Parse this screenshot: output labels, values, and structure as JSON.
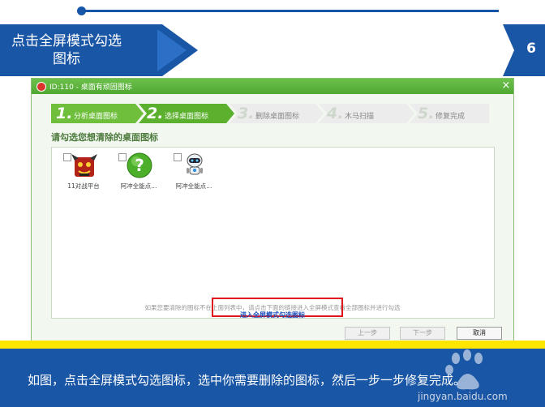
{
  "slide": {
    "title": "点击全屏模式勾选\n图标",
    "page_number": "6",
    "caption": "如图，点击全屏模式勾选图标，选中你需要删除的图标，然后一步一步修复完成。"
  },
  "dialog": {
    "window_title": "ID:110 - 桌面有顽固图标",
    "close_glyph": "×",
    "steps": [
      {
        "num": "1.",
        "label": "分析桌面图标",
        "state": "done"
      },
      {
        "num": "2.",
        "label": "选择桌面图标",
        "state": "active"
      },
      {
        "num": "3.",
        "label": "删除桌面图标",
        "state": "pending"
      },
      {
        "num": "4.",
        "label": "木马扫描",
        "state": "pending"
      },
      {
        "num": "5.",
        "label": "修复完成",
        "state": "pending"
      }
    ],
    "instruction": "请勾选您想清除的桌面图标",
    "icons": [
      {
        "caption": "11对战平台",
        "icon": "demon-game-icon"
      },
      {
        "caption": "阿冲全能点...",
        "icon": "green-question-icon"
      },
      {
        "caption": "阿冲全能点...",
        "icon": "robot-icon"
      }
    ],
    "hint": "如果您要清除的图标不在上面列表中，请点击下面的链接进入全屏模式查看全部图标并进行勾选",
    "fullscreen_link": "进入全屏模式勾选图标",
    "buttons": {
      "prev": "上一步",
      "next": "下一步",
      "cancel": "取消"
    }
  },
  "colors": {
    "brand_blue": "#1a56a6",
    "titlebar_green": "#4fa832",
    "highlight_red": "#e0141c",
    "accent_yellow": "#ffe600"
  },
  "watermark": "jingyan.baidu.com"
}
